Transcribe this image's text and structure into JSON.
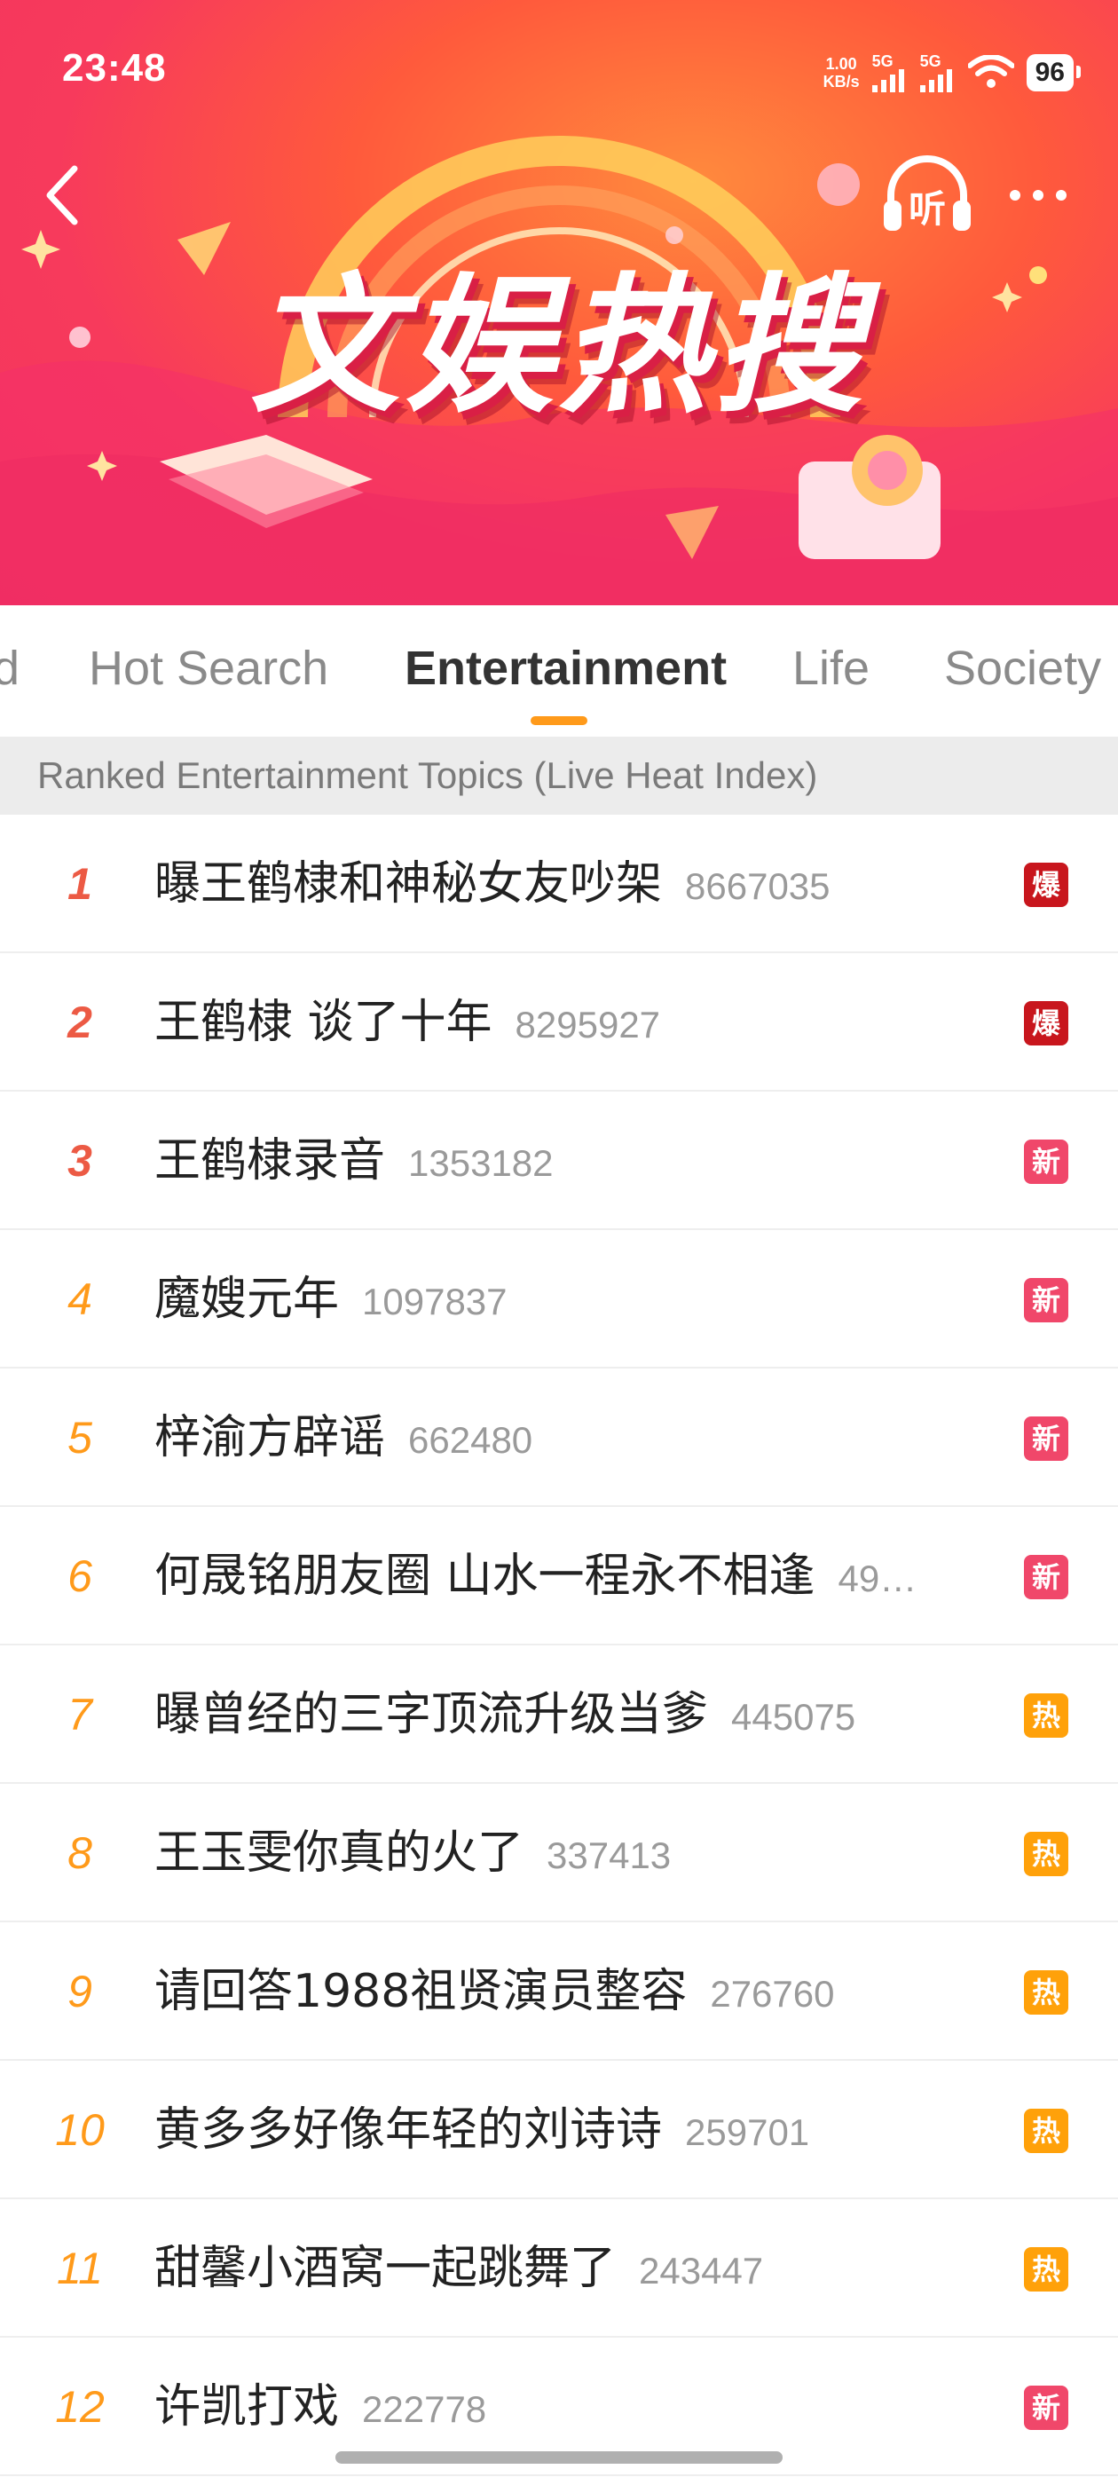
{
  "status_bar": {
    "time": "23:48",
    "net_speed_value": "1.00",
    "net_speed_unit": "KB/s",
    "signal1_label": "5G",
    "signal2_label": "5G",
    "battery": "96"
  },
  "header": {
    "banner_title": "文娱热搜",
    "listen_label": "听"
  },
  "tabs": [
    {
      "label": "d"
    },
    {
      "label": "Hot Search"
    },
    {
      "label": "Entertainment"
    },
    {
      "label": "Life"
    },
    {
      "label": "Society"
    }
  ],
  "active_tab": "Entertainment",
  "list_header": "Ranked Entertainment Topics (Live Heat Index)",
  "badge_colors": {
    "爆": "#c8161d",
    "新": "#f0476a",
    "热": "#ffa10a"
  },
  "rank_colors": {
    "top3": "#ec5a44",
    "rest": "#ff9a1a"
  },
  "items": [
    {
      "rank": "1",
      "topic": "曝王鹤棣和神秘女友吵架",
      "heat": "8667035",
      "badge": "爆"
    },
    {
      "rank": "2",
      "topic": "王鹤棣 谈了十年",
      "heat": "8295927",
      "badge": "爆"
    },
    {
      "rank": "3",
      "topic": "王鹤棣录音",
      "heat": "1353182",
      "badge": "新"
    },
    {
      "rank": "4",
      "topic": "魔嫂元年",
      "heat": "1097837",
      "badge": "新"
    },
    {
      "rank": "5",
      "topic": "梓渝方辟谣",
      "heat": "662480",
      "badge": "新"
    },
    {
      "rank": "6",
      "topic": "何晟铭朋友圈 山水一程永不相逢",
      "heat": "49…",
      "badge": "新"
    },
    {
      "rank": "7",
      "topic": "曝曾经的三字顶流升级当爹",
      "heat": "445075",
      "badge": "热"
    },
    {
      "rank": "8",
      "topic": "王玉雯你真的火了",
      "heat": "337413",
      "badge": "热"
    },
    {
      "rank": "9",
      "topic": "请回答1988祖贤演员整容",
      "heat": "276760",
      "badge": "热"
    },
    {
      "rank": "10",
      "topic": "黄多多好像年轻的刘诗诗",
      "heat": "259701",
      "badge": "热"
    },
    {
      "rank": "11",
      "topic": "甜馨小酒窝一起跳舞了",
      "heat": "243447",
      "badge": "热"
    },
    {
      "rank": "12",
      "topic": "许凯打戏",
      "heat": "222778",
      "badge": "新"
    }
  ]
}
